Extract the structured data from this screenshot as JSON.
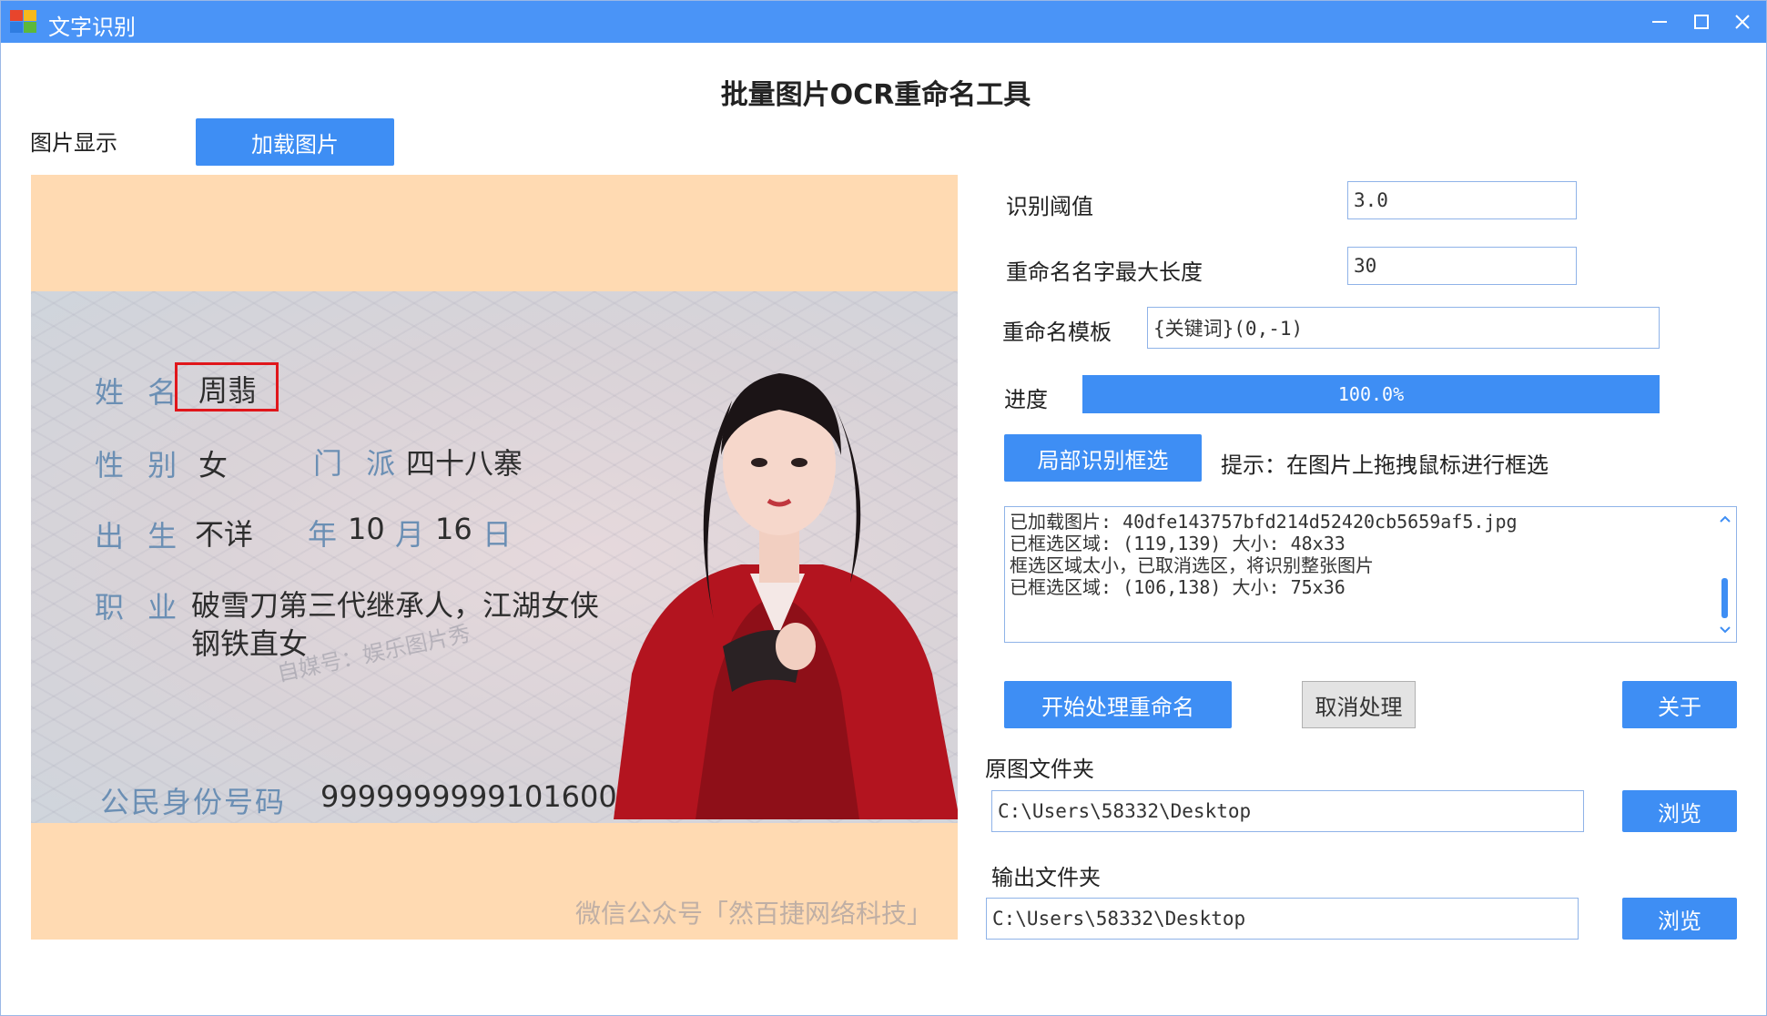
{
  "window": {
    "title": "文字识别",
    "minimize": "—",
    "maximize": "☐",
    "close": "✕"
  },
  "header": {
    "title": "批量图片OCR重命名工具"
  },
  "image_panel": {
    "label": "图片显示",
    "load_button": "加载图片",
    "watermark": "微信公众号「然百捷网络科技」",
    "card": {
      "name_label": "姓 名",
      "name_value": "周翡",
      "sex_label": "性 别",
      "sex_value": "女",
      "sect_label": "门 派",
      "sect_value": "四十八寨",
      "birth_label": "出 生",
      "birth_value": "不详",
      "year_label": "年",
      "month_value": "10",
      "month_label": "月",
      "day_value": "16",
      "day_label": "日",
      "job_label": "职 业",
      "job_line1": "破雪刀第三代继承人，江湖女侠",
      "job_line2": "钢铁直女",
      "id_label": "公民身份号码",
      "id_value": "999999999910160002",
      "card_watermark": "自媒号：娱乐图片秀"
    }
  },
  "settings": {
    "threshold_label": "识别阈值",
    "threshold_value": "3.0",
    "maxlen_label": "重命名名字最大长度",
    "maxlen_value": "30",
    "template_label": "重命名模板",
    "template_value": "{关键词}(0,-1)",
    "progress_label": "进度",
    "progress_text": "100.0%",
    "progress_value": 1.0
  },
  "region": {
    "button": "局部识别框选",
    "hint": "提示：在图片上拖拽鼠标进行框选"
  },
  "log": {
    "lines": [
      "已加载图片: 40dfe143757bfd214d52420cb5659af5.jpg",
      "已框选区域: (119,139) 大小: 48x33",
      "框选区域太小，已取消选区，将识别整张图片",
      "已框选区域: (106,138) 大小: 75x36"
    ]
  },
  "actions": {
    "start": "开始处理重命名",
    "cancel": "取消处理",
    "about": "关于"
  },
  "folders": {
    "source_label": "原图文件夹",
    "source_value": "C:\\Users\\58332\\Desktop",
    "source_browse": "浏览",
    "output_label": "输出文件夹",
    "output_value": "C:\\Users\\58332\\Desktop",
    "output_browse": "浏览"
  },
  "colors": {
    "titlebar": "#4a94f7",
    "accent": "#3e8ef4",
    "image_bg": "#ffdab2",
    "selection": "#e0161b"
  }
}
